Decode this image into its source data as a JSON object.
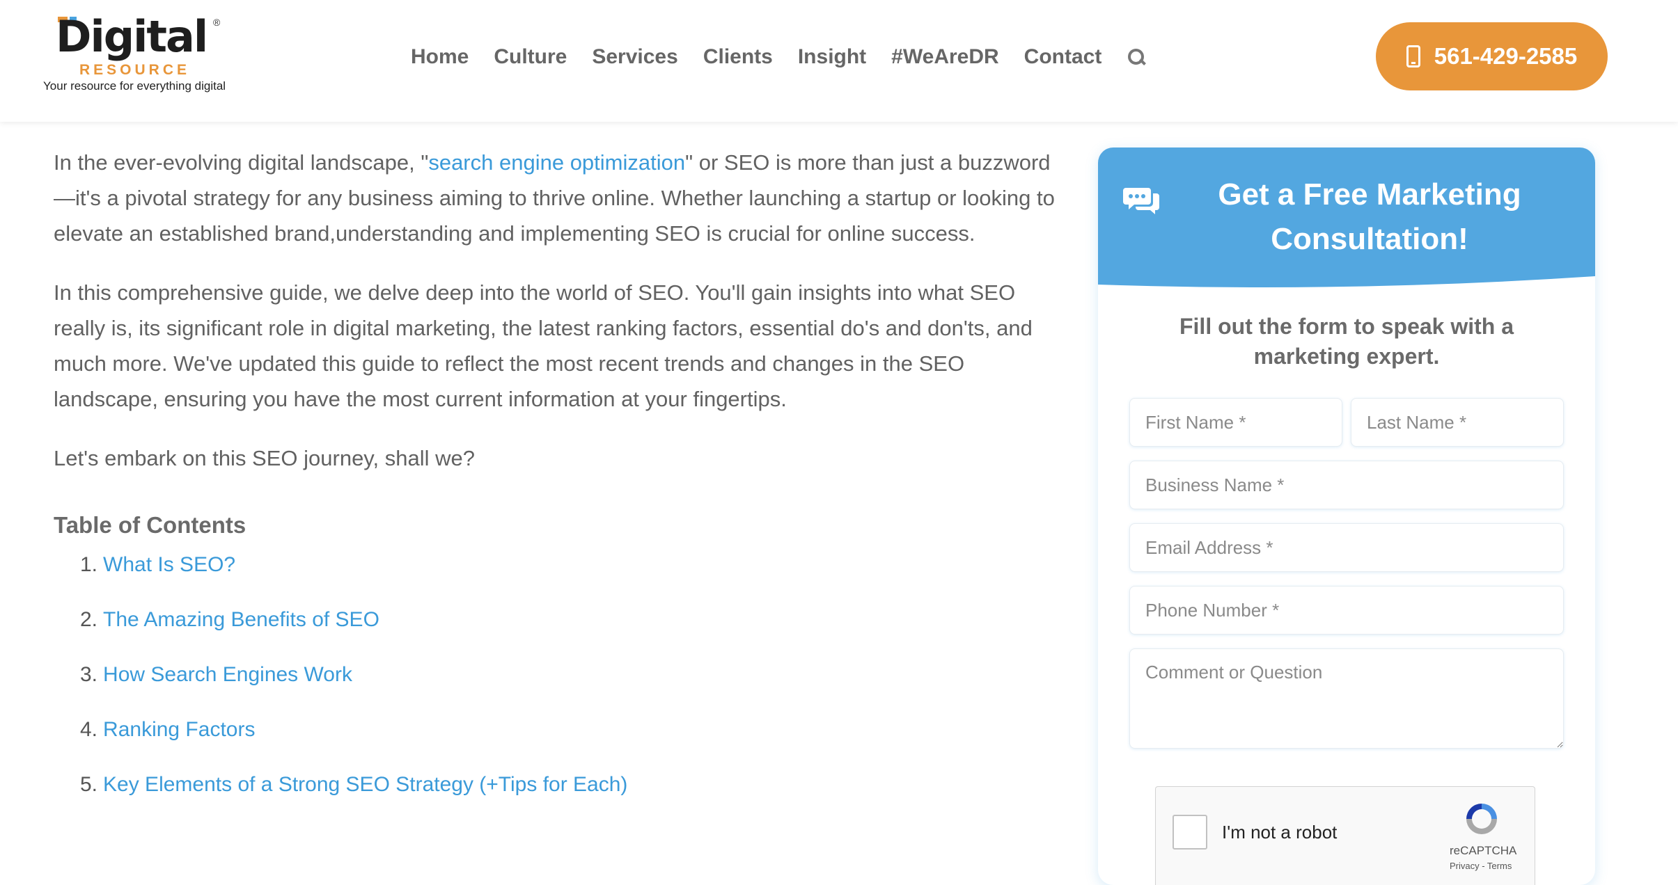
{
  "logo": {
    "word": "Digital",
    "registered": "®",
    "sub": "RESOURCE",
    "tagline": "Your resource for everything digital",
    "colors": {
      "orange": "#e8963a",
      "blue": "#4aa3df"
    }
  },
  "nav": {
    "items": [
      "Home",
      "Culture",
      "Services",
      "Clients",
      "Insight",
      "#WeAreDR",
      "Contact"
    ],
    "search_icon": "search-icon"
  },
  "phone": {
    "label": "561-429-2585",
    "icon": "mobile-phone-icon",
    "color": "#e8963a"
  },
  "article": {
    "p1_before": "In the ever-evolving digital landscape, \"",
    "p1_link": "search engine optimization",
    "p1_after": "\" or SEO is more than just a buzzword—it's a pivotal strategy for any business aiming to thrive online. Whether launching a startup or looking to elevate an established brand,understanding and implementing SEO is crucial for online success.",
    "p2": "In this comprehensive guide, we delve deep into the world of SEO. You'll gain insights into what SEO really is, its significant role in digital marketing, the latest ranking factors, essential do's and don'ts, and much more. We've updated this guide to reflect the most recent trends and changes in the SEO landscape, ensuring you have the most current information at your fingertips.",
    "p3": "Let's embark on this SEO journey, shall we?",
    "toc_heading": "Table of Contents",
    "toc": [
      {
        "num": "1.",
        "label": "What Is SEO?"
      },
      {
        "num": "2.",
        "label": "The Amazing Benefits of SEO"
      },
      {
        "num": "3.",
        "label": "How Search Engines Work"
      },
      {
        "num": "4.",
        "label": "Ranking Factors"
      },
      {
        "num": "5.",
        "label": "Key Elements of a Strong SEO Strategy (+Tips for Each)"
      }
    ],
    "link_color": "#3a9ad9"
  },
  "form": {
    "title": "Get a Free Marketing Consultation!",
    "subtitle": "Fill out the form to speak with a marketing expert.",
    "header_color": "#53a7e0",
    "icon": "chat-bubble-icon",
    "fields": {
      "first_name": "First Name *",
      "last_name": "Last Name *",
      "business": "Business Name *",
      "email": "Email Address *",
      "phone": "Phone Number *",
      "comment": "Comment or Question"
    },
    "recaptcha": {
      "label": "I'm not a robot",
      "brand": "reCAPTCHA",
      "terms": "Privacy - Terms"
    }
  }
}
